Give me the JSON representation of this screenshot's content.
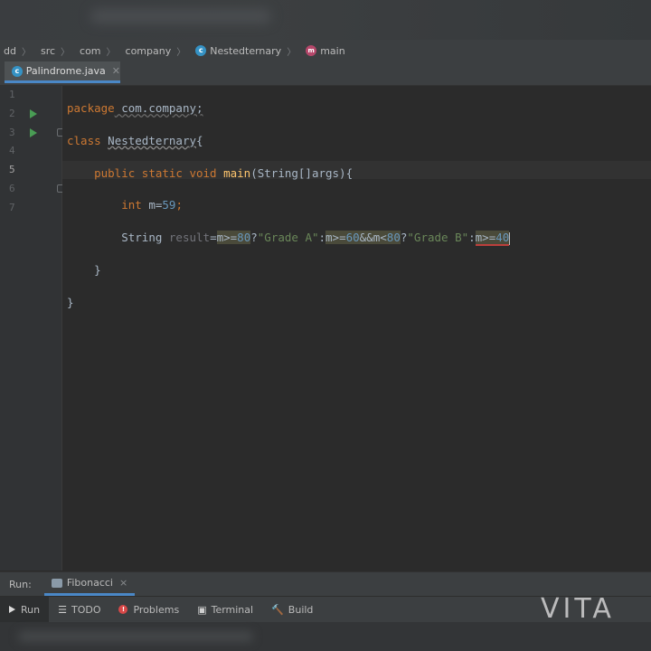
{
  "breadcrumb": {
    "items": [
      "dd",
      "src",
      "com",
      "company",
      "Nestedternary",
      "main"
    ]
  },
  "tabs": [
    {
      "label": "Palindrome.java"
    }
  ],
  "gutter": {
    "line_numbers": [
      "1",
      "2",
      "3",
      "4",
      "5",
      "6",
      "7"
    ]
  },
  "code": {
    "line1": {
      "kw": "package",
      "rest": " com.company;"
    },
    "line2": {
      "kw": "class",
      "name": "Nestedternary",
      "brace": "{"
    },
    "line3": {
      "kw": "public static void",
      "fn": "main",
      "args": "(String[]args){"
    },
    "line4": {
      "kw": "int",
      "var": " m=",
      "num": "59",
      "semi": ";"
    },
    "line5": {
      "type": "String ",
      "var": "result",
      "eq": "=",
      "cond1": "m>=",
      "n80": "80",
      "q1": "?",
      "s1": "\"Grade A\"",
      "c1": ":",
      "cond2": "m>=",
      "n60": "60",
      "and": "&&",
      "cond3": "m<",
      "n80b": "80",
      "q2": "?",
      "s2": "\"Grade B\"",
      "c2": ":",
      "cond4": "m>=",
      "n40": "40"
    },
    "line6": {
      "brace": "}"
    },
    "line7": {
      "brace": "}"
    }
  },
  "run_panel": {
    "label": "Run:",
    "tab": "Fibonacci",
    "close": "×"
  },
  "tool_windows": [
    "Run",
    "TODO",
    "Problems",
    "Terminal",
    "Build"
  ],
  "watermark": "VITA",
  "colors": {
    "accent": "#4a88c7",
    "keyword": "#cc7832",
    "string": "#6a8759",
    "number": "#6897bb",
    "error": "#d74848"
  }
}
